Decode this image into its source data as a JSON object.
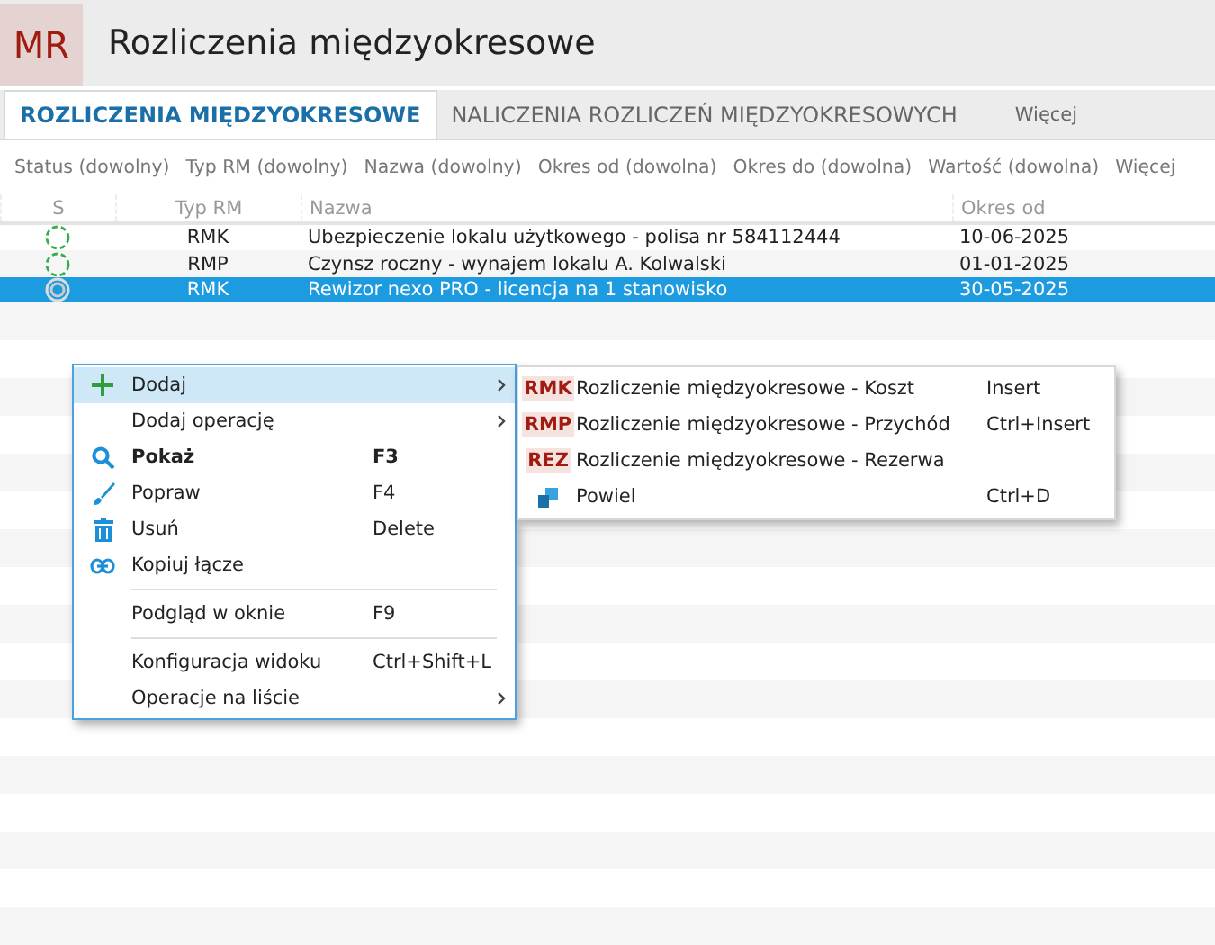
{
  "header": {
    "logo": "MR",
    "title": "Rozliczenia międzyokresowe"
  },
  "tabs": [
    {
      "label": "ROZLICZENIA MIĘDZYOKRESOWE",
      "selected": true
    },
    {
      "label": "NALICZENIA ROZLICZEŃ MIĘDZYOKRESOWYCH",
      "selected": false
    },
    {
      "label": "Więcej",
      "selected": false
    }
  ],
  "filters": [
    "Status (dowolny)",
    "Typ RM (dowolny)",
    "Nazwa (dowolny)",
    "Okres od (dowolna)",
    "Okres do (dowolna)",
    "Wartość (dowolna)",
    "Więcej"
  ],
  "table": {
    "columns": [
      "S",
      "Typ RM",
      "Nazwa",
      "Okres od"
    ],
    "rows": [
      {
        "type": "RMK",
        "name": "Ubezpieczenie lokalu użytkowego - polisa nr 584112444",
        "from": "10-06-2025",
        "selected": false
      },
      {
        "type": "RMP",
        "name": "Czynsz roczny - wynajem lokalu A. Kolwalski",
        "from": "01-01-2025",
        "selected": false
      },
      {
        "type": "RMK",
        "name": "Rewizor nexo PRO - licencja na 1 stanowisko",
        "from": "30-05-2025",
        "selected": true
      }
    ]
  },
  "context_menu": [
    {
      "kind": "add",
      "label": "Dodaj",
      "submenu": true,
      "selected": true,
      "bold": false
    },
    {
      "kind": "plain",
      "label": "Dodaj operację",
      "submenu": true,
      "selected": false,
      "bold": false
    },
    {
      "kind": "show",
      "label": "Pokaż",
      "shortcut": "F3",
      "submenu": false,
      "selected": false,
      "bold": true
    },
    {
      "kind": "edit",
      "label": "Popraw",
      "shortcut": "F4",
      "submenu": false,
      "selected": false,
      "bold": false
    },
    {
      "kind": "delete",
      "label": "Usuń",
      "shortcut": "Delete",
      "submenu": false,
      "selected": false,
      "bold": false
    },
    {
      "kind": "link",
      "label": "Kopiuj łącze",
      "submenu": false,
      "selected": false,
      "bold": false
    },
    {
      "kind": "separator"
    },
    {
      "kind": "plain",
      "label": "Podgląd w oknie",
      "shortcut": "F9",
      "submenu": false,
      "selected": false,
      "bold": false
    },
    {
      "kind": "separator"
    },
    {
      "kind": "plain",
      "label": "Konfiguracja widoku",
      "shortcut": "Ctrl+Shift+L",
      "submenu": false,
      "selected": false,
      "bold": false
    },
    {
      "kind": "plain",
      "label": "Operacje na liście",
      "submenu": true,
      "selected": false,
      "bold": false
    }
  ],
  "submenu": [
    {
      "kind": "badge",
      "badge": "RMK",
      "label": "Rozliczenie międzyokresowe - Koszt",
      "shortcut": "Insert"
    },
    {
      "kind": "badge",
      "badge": "RMP",
      "label": "Rozliczenie międzyokresowe - Przychód",
      "shortcut": "Ctrl+Insert"
    },
    {
      "kind": "badge",
      "badge": "REZ",
      "label": "Rozliczenie międzyokresowe - Rezerwa"
    },
    {
      "kind": "copy",
      "label": "Powiel",
      "shortcut": "Ctrl+D"
    }
  ]
}
